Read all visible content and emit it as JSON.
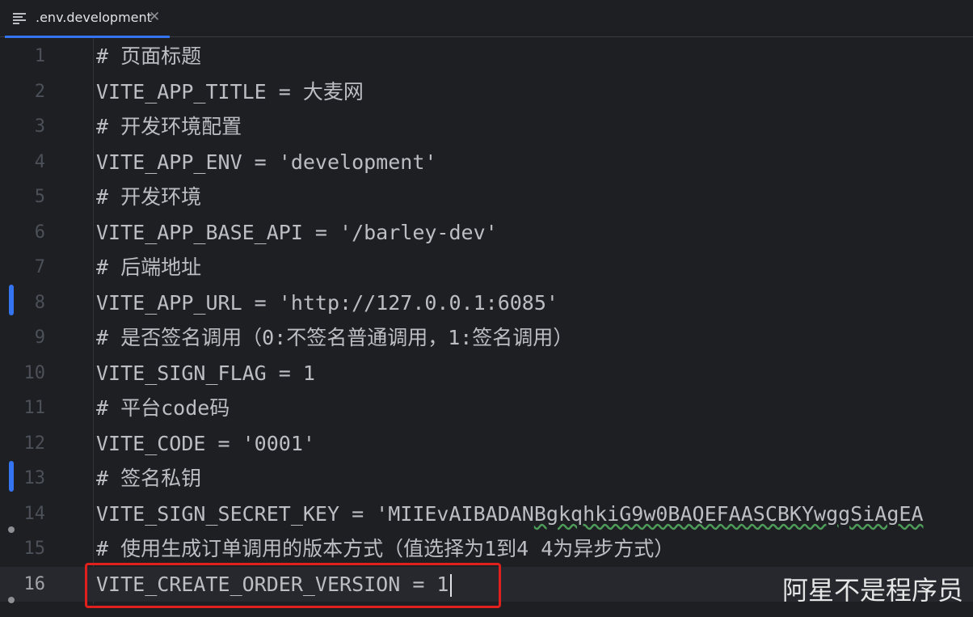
{
  "tab": {
    "filename": ".env.development",
    "close_glyph": "✕",
    "icon": "text-file-icon"
  },
  "editor": {
    "current_line": 16,
    "lines": [
      {
        "number": "1",
        "text": "# 页面标题"
      },
      {
        "number": "2",
        "text": "VITE_APP_TITLE = 大麦网"
      },
      {
        "number": "3",
        "text": "# 开发环境配置"
      },
      {
        "number": "4",
        "text": "VITE_APP_ENV = 'development'"
      },
      {
        "number": "5",
        "text": "# 开发环境"
      },
      {
        "number": "6",
        "text": "VITE_APP_BASE_API = '/barley-dev'"
      },
      {
        "number": "7",
        "text": "# 后端地址"
      },
      {
        "number": "8",
        "text": "VITE_APP_URL = 'http://127.0.0.1:6085'"
      },
      {
        "number": "9",
        "text": "# 是否签名调用（0:不签名普通调用，1:签名调用）"
      },
      {
        "number": "10",
        "text": "VITE_SIGN_FLAG = 1"
      },
      {
        "number": "11",
        "text": "# 平台code码"
      },
      {
        "number": "12",
        "text": "VITE_CODE = '0001'"
      },
      {
        "number": "13",
        "text": "# 签名私钥"
      },
      {
        "number": "14",
        "text": "VITE_SIGN_SECRET_KEY = 'MIIEvAIBADANBgkqhkiG9w0BAQEFAASCBKYwggSiAgEA"
      },
      {
        "number": "15",
        "text": "# 使用生成订单调用的版本方式（值选择为1到4 4为异步方式）"
      },
      {
        "number": "16",
        "text": "VITE_CREATE_ORDER_VERSION = 1"
      }
    ]
  },
  "watermark": "阿星不是程序员",
  "colors": {
    "background": "#1e1f22",
    "accent": "#3574f0",
    "highlight_box": "#e0201d"
  }
}
